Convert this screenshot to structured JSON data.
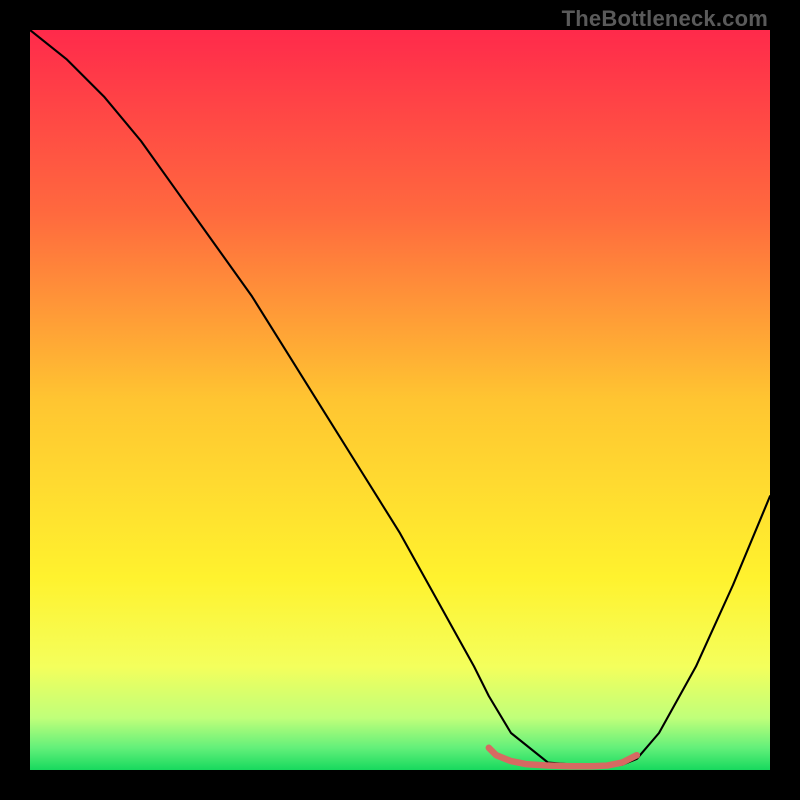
{
  "watermark": "TheBottleneck.com",
  "chart_data": {
    "type": "line",
    "title": "",
    "xlabel": "",
    "ylabel": "",
    "xlim": [
      0,
      100
    ],
    "ylim": [
      0,
      100
    ],
    "grid": false,
    "legend": false,
    "gradient_stops": [
      {
        "offset": 0.0,
        "color": "#ff2a4b"
      },
      {
        "offset": 0.25,
        "color": "#ff6a3e"
      },
      {
        "offset": 0.5,
        "color": "#ffc531"
      },
      {
        "offset": 0.74,
        "color": "#fff22e"
      },
      {
        "offset": 0.86,
        "color": "#f4ff5c"
      },
      {
        "offset": 0.93,
        "color": "#bfff7a"
      },
      {
        "offset": 0.97,
        "color": "#63f07a"
      },
      {
        "offset": 1.0,
        "color": "#17d95e"
      }
    ],
    "series": [
      {
        "name": "bottleneck_curve",
        "color": "#000000",
        "width": 2.1,
        "x": [
          0,
          5,
          10,
          15,
          20,
          25,
          30,
          35,
          40,
          45,
          50,
          55,
          60,
          62,
          65,
          70,
          75,
          78,
          80,
          82,
          85,
          90,
          95,
          100
        ],
        "values": [
          100,
          96,
          91,
          85,
          78,
          71,
          64,
          56,
          48,
          40,
          32,
          23,
          14,
          10,
          5,
          1,
          0.6,
          0.5,
          0.7,
          1.5,
          5,
          14,
          25,
          37
        ]
      },
      {
        "name": "optimal_band_marker",
        "color": "#d66a62",
        "width": 6.5,
        "x": [
          62,
          63,
          65,
          67,
          70,
          73,
          76,
          78,
          80,
          82
        ],
        "values": [
          3.0,
          2.0,
          1.2,
          0.8,
          0.6,
          0.5,
          0.5,
          0.6,
          1.0,
          2.0
        ]
      }
    ]
  }
}
